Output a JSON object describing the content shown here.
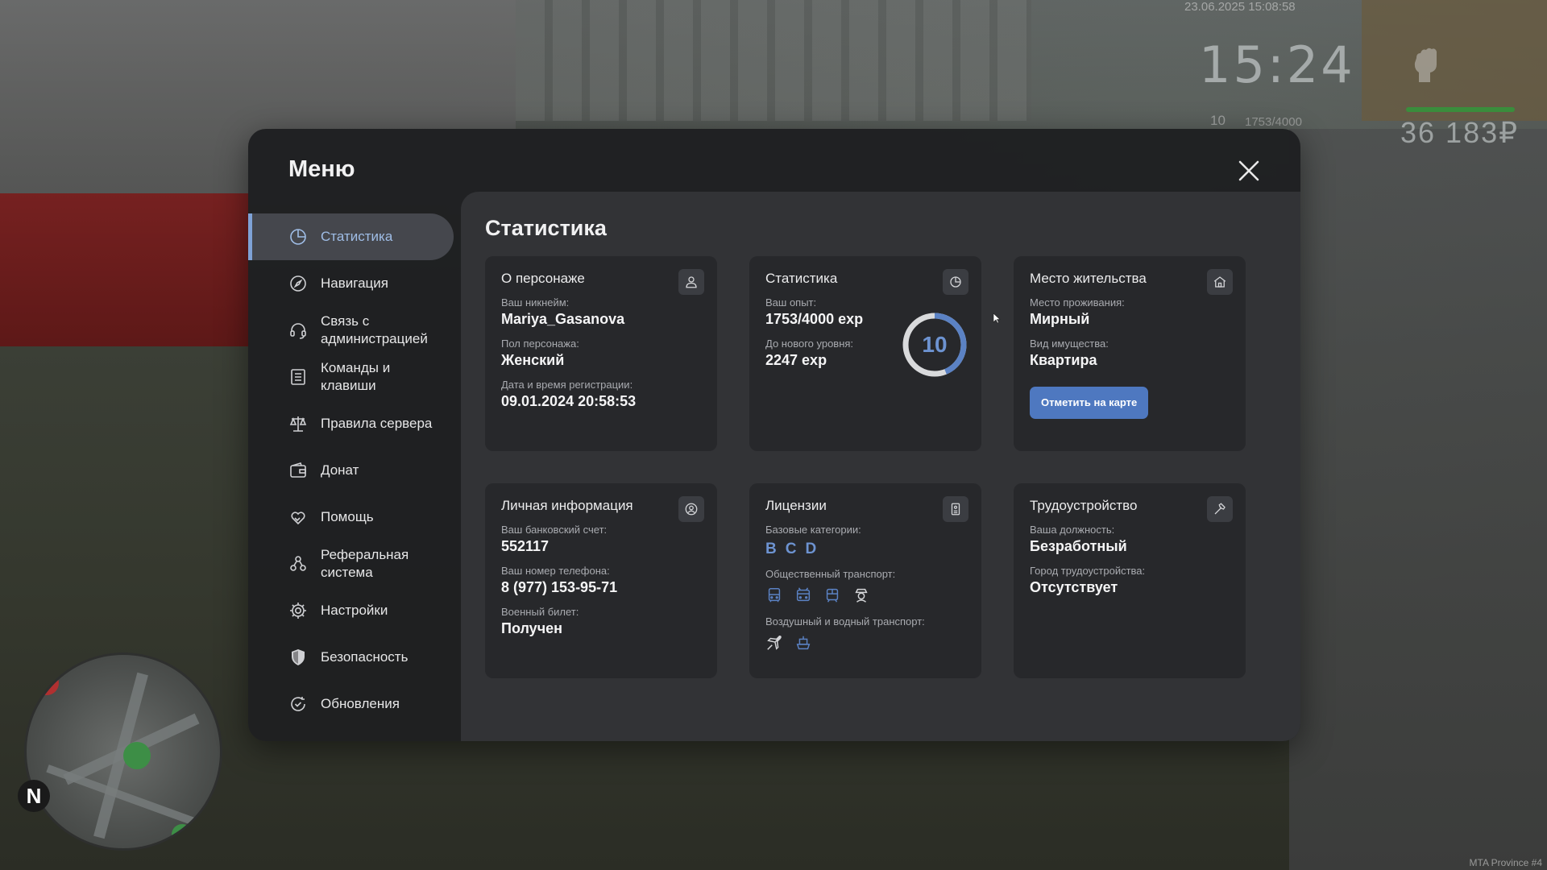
{
  "hud": {
    "datetime": "23.06.2025 15:08:58",
    "clock": "15:24",
    "level": "10",
    "exp": "1753/4000",
    "money": "36 183₽",
    "watermark": "MTA Province #4",
    "compass": "N"
  },
  "menu": {
    "title": "Меню",
    "close_icon": "close-icon",
    "accent_color": "#7ea2d6",
    "sidebar": [
      {
        "label": "Статистика",
        "icon": "pie-chart-icon",
        "active": true
      },
      {
        "label": "Навигация",
        "icon": "compass-icon"
      },
      {
        "label": "Связь с администрацией",
        "icon": "headset-icon"
      },
      {
        "label": "Команды и клавиши",
        "icon": "document-list-icon"
      },
      {
        "label": "Правила сервера",
        "icon": "scales-icon"
      },
      {
        "label": "Донат",
        "icon": "wallet-icon"
      },
      {
        "label": "Помощь",
        "icon": "heart-hand-icon"
      },
      {
        "label": "Реферальная система",
        "icon": "referral-icon"
      },
      {
        "label": "Настройки",
        "icon": "gear-icon"
      },
      {
        "label": "Безопасность",
        "icon": "shield-icon"
      },
      {
        "label": "Обновления",
        "icon": "refresh-check-icon"
      }
    ]
  },
  "content": {
    "title": "Статистика",
    "about": {
      "title": "О персонаже",
      "nick_label": "Ваш никнейм:",
      "nick": "Mariya_Gasanova",
      "gender_label": "Пол персонажа:",
      "gender": "Женский",
      "reg_label": "Дата и время регистрации:",
      "reg": "09.01.2024 20:58:53"
    },
    "stats": {
      "title": "Статистика",
      "exp_label": "Ваш опыт:",
      "exp": "1753/4000 exp",
      "next_label": "До нового уровня:",
      "next": "2247 exp",
      "level": "10",
      "progress": 0.438
    },
    "residence": {
      "title": "Место жительства",
      "place_label": "Место проживания:",
      "place": "Мирный",
      "property_label": "Вид имущества:",
      "property": "Квартира",
      "button": "Отметить на карте"
    },
    "personal": {
      "title": "Личная информация",
      "bank_label": "Ваш банковский счет:",
      "bank": "552117",
      "phone_label": "Ваш номер телефона:",
      "phone": "8 (977) 153-95-71",
      "military_label": "Военный билет:",
      "military": "Получен"
    },
    "licenses": {
      "title": "Лицензии",
      "base_label": "Базовые категории:",
      "categories": [
        "B",
        "C",
        "D"
      ],
      "public_label": "Общественный транспорт:",
      "public_icons": [
        "bus-icon",
        "trolleybus-icon",
        "tram-icon",
        "taxi-driver-icon"
      ],
      "air_label": "Воздушный и водный транспорт:",
      "air_icons": [
        "plane-icon",
        "boat-icon"
      ]
    },
    "employment": {
      "title": "Трудоустройство",
      "position_label": "Ваша должность:",
      "position": "Безработный",
      "city_label": "Город трудоустройства:",
      "city": "Отсутствует"
    }
  }
}
